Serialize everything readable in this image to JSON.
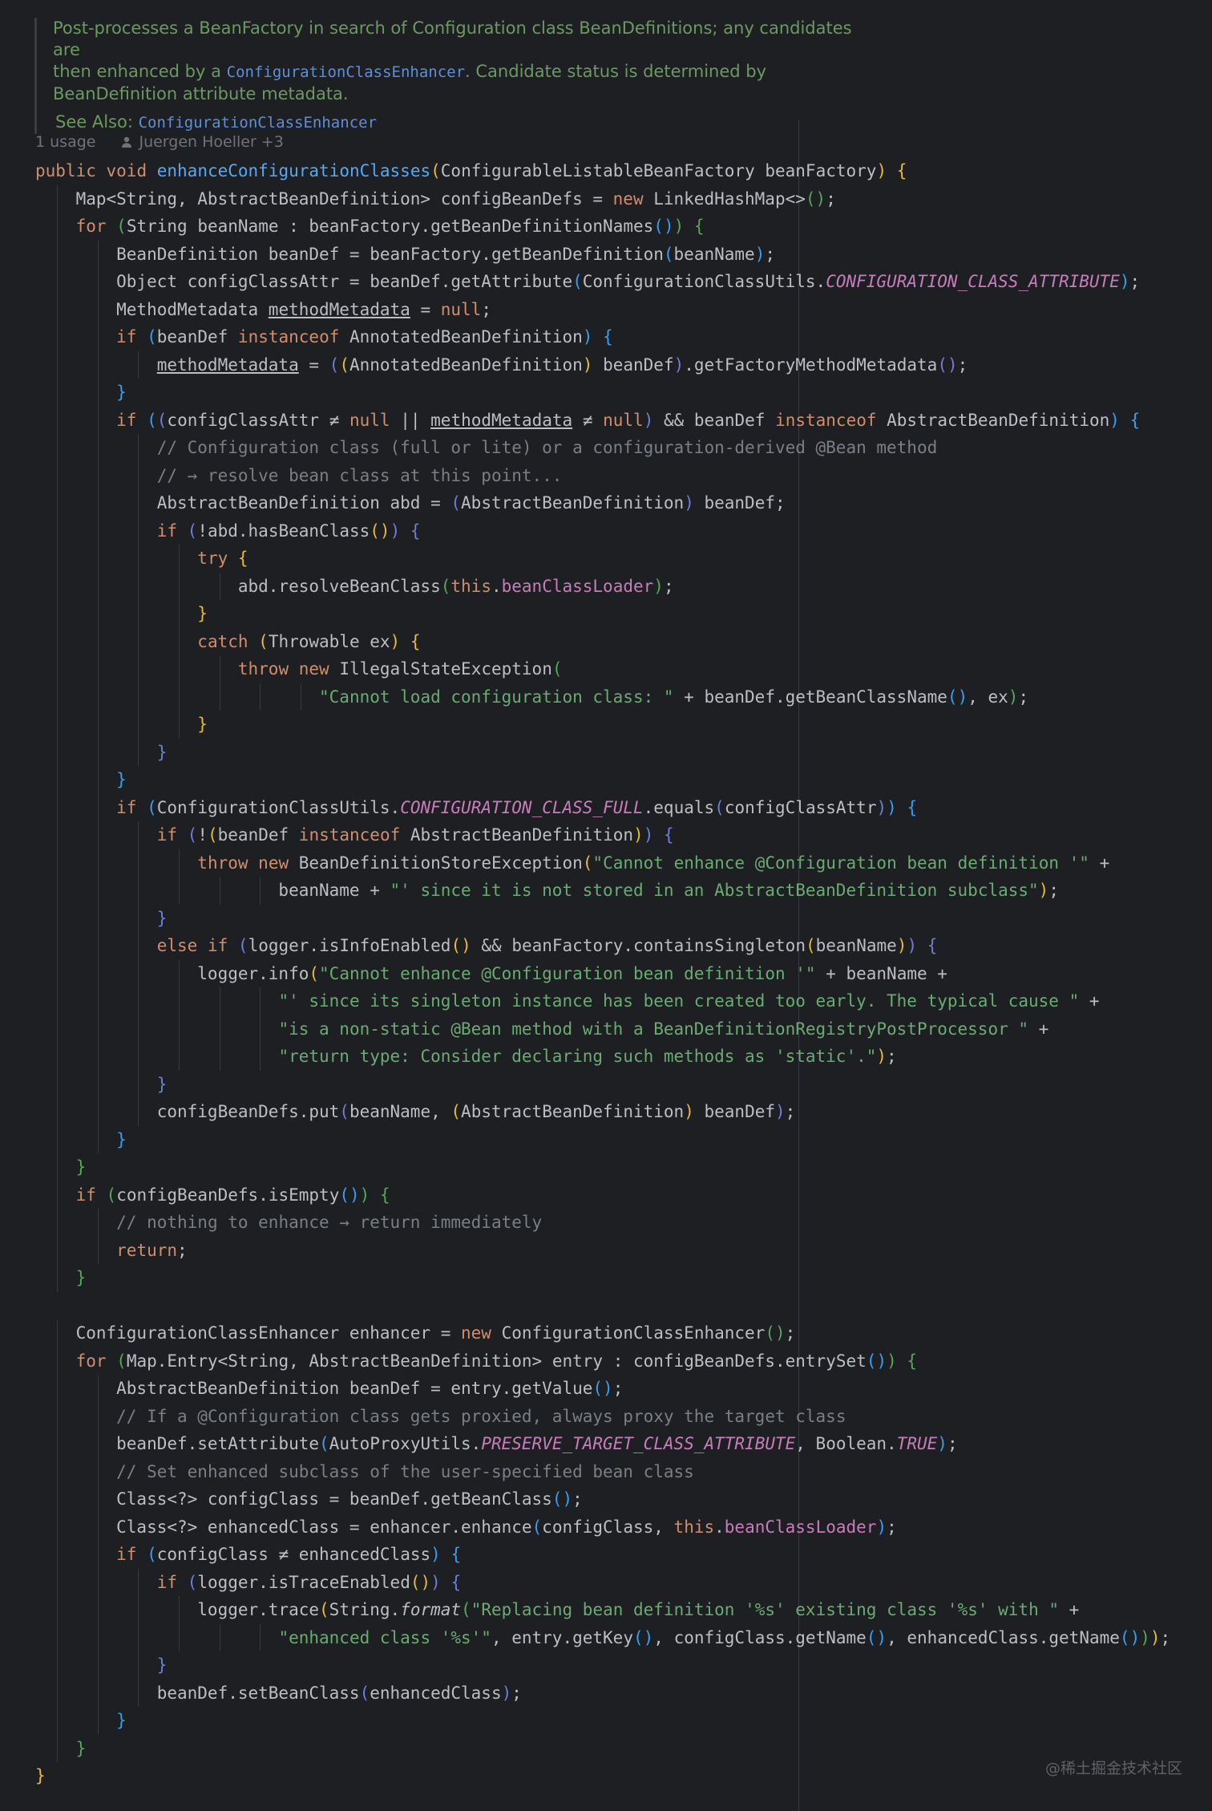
{
  "javadoc": {
    "line1": "Post-processes a BeanFactory in search of Configuration class BeanDefinitions; any candidates are",
    "line2_before": "then enhanced by a ",
    "line2_code": "ConfigurationClassEnhancer",
    "line2_after": ". Candidate status is determined by",
    "line3": "BeanDefinition attribute metadata.",
    "see_also_label": "See Also: ",
    "see_also_link": "ConfigurationClassEnhancer"
  },
  "inlay": {
    "usages": "1 usage",
    "author": "Juergen Hoeller +3",
    "author_icon": "person-icon"
  },
  "code_lines": [
    "public void enhanceConfigurationClasses(ConfigurableListableBeanFactory beanFactory) {",
    "    Map<String, AbstractBeanDefinition> configBeanDefs = new LinkedHashMap<>();",
    "    for (String beanName : beanFactory.getBeanDefinitionNames()) {",
    "        BeanDefinition beanDef = beanFactory.getBeanDefinition(beanName);",
    "        Object configClassAttr = beanDef.getAttribute(ConfigurationClassUtils.CONFIGURATION_CLASS_ATTRIBUTE);",
    "        MethodMetadata methodMetadata = null;",
    "        if (beanDef instanceof AnnotatedBeanDefinition) {",
    "            methodMetadata = ((AnnotatedBeanDefinition) beanDef).getFactoryMethodMetadata();",
    "        }",
    "        if ((configClassAttr ≠ null || methodMetadata ≠ null) && beanDef instanceof AbstractBeanDefinition) {",
    "            // Configuration class (full or lite) or a configuration-derived @Bean method",
    "            // → resolve bean class at this point...",
    "            AbstractBeanDefinition abd = (AbstractBeanDefinition) beanDef;",
    "            if (!abd.hasBeanClass()) {",
    "                try {",
    "                    abd.resolveBeanClass(this.beanClassLoader);",
    "                }",
    "                catch (Throwable ex) {",
    "                    throw new IllegalStateException(",
    "                            \"Cannot load configuration class: \" + beanDef.getBeanClassName(), ex);",
    "                }",
    "            }",
    "        }",
    "        if (ConfigurationClassUtils.CONFIGURATION_CLASS_FULL.equals(configClassAttr)) {",
    "            if (!(beanDef instanceof AbstractBeanDefinition)) {",
    "                throw new BeanDefinitionStoreException(\"Cannot enhance @Configuration bean definition '\" +",
    "                        beanName + \"' since it is not stored in an AbstractBeanDefinition subclass\");",
    "            }",
    "            else if (logger.isInfoEnabled() && beanFactory.containsSingleton(beanName)) {",
    "                logger.info(\"Cannot enhance @Configuration bean definition '\" + beanName +",
    "                        \"' since its singleton instance has been created too early. The typical cause \" +",
    "                        \"is a non-static @Bean method with a BeanDefinitionRegistryPostProcessor \" +",
    "                        \"return type: Consider declaring such methods as 'static'.\");",
    "            }",
    "            configBeanDefs.put(beanName, (AbstractBeanDefinition) beanDef);",
    "        }",
    "    }",
    "    if (configBeanDefs.isEmpty()) {",
    "        // nothing to enhance → return immediately",
    "        return;",
    "    }",
    "",
    "    ConfigurationClassEnhancer enhancer = new ConfigurationClassEnhancer();",
    "    for (Map.Entry<String, AbstractBeanDefinition> entry : configBeanDefs.entrySet()) {",
    "        AbstractBeanDefinition beanDef = entry.getValue();",
    "        // If a @Configuration class gets proxied, always proxy the target class",
    "        beanDef.setAttribute(AutoProxyUtils.PRESERVE_TARGET_CLASS_ATTRIBUTE, Boolean.TRUE);",
    "        // Set enhanced subclass of the user-specified bean class",
    "        Class<?> configClass = beanDef.getBeanClass();",
    "        Class<?> enhancedClass = enhancer.enhance(configClass, this.beanClassLoader);",
    "        if (configClass ≠ enhancedClass) {",
    "            if (logger.isTraceEnabled()) {",
    "                logger.trace(String.format(\"Replacing bean definition '%s' existing class '%s' with \" +",
    "                        \"enhanced class '%s'\", entry.getKey(), configClass.getName(), enhancedClass.getName()));",
    "            }",
    "            beanDef.setBeanClass(enhancedClass);",
    "        }",
    "    }",
    "}"
  ],
  "watermark": "@稀土掘金技术社区"
}
